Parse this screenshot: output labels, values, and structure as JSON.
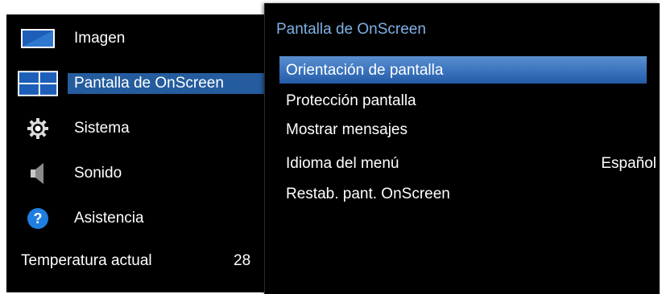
{
  "left_menu": {
    "items": [
      {
        "label": "Imagen",
        "icon": "picture-icon",
        "selected": false
      },
      {
        "label": "Pantalla de OnScreen",
        "icon": "onscreen-display-icon",
        "selected": true
      },
      {
        "label": "Sistema",
        "icon": "gear-icon",
        "selected": false
      },
      {
        "label": "Sonido",
        "icon": "speaker-icon",
        "selected": false
      },
      {
        "label": "Asistencia",
        "icon": "help-icon",
        "selected": false
      }
    ],
    "temperature": {
      "label": "Temperatura actual",
      "value": "28"
    }
  },
  "submenu": {
    "title": "Pantalla de OnScreen",
    "items": [
      {
        "label": "Orientación de pantalla",
        "value": ""
      },
      {
        "label": "Protección pantalla",
        "value": ""
      },
      {
        "label": "Mostrar mensajes",
        "value": ""
      },
      {
        "label": "Idioma del menú",
        "value": "Español"
      },
      {
        "label": "Restab. pant. OnScreen",
        "value": ""
      }
    ]
  },
  "colors": {
    "background": "#000000",
    "title_accent": "#7fb1e6",
    "selection": "#245c9e",
    "highlight": "#3a73bd",
    "help_icon": "#1f7fe0"
  }
}
